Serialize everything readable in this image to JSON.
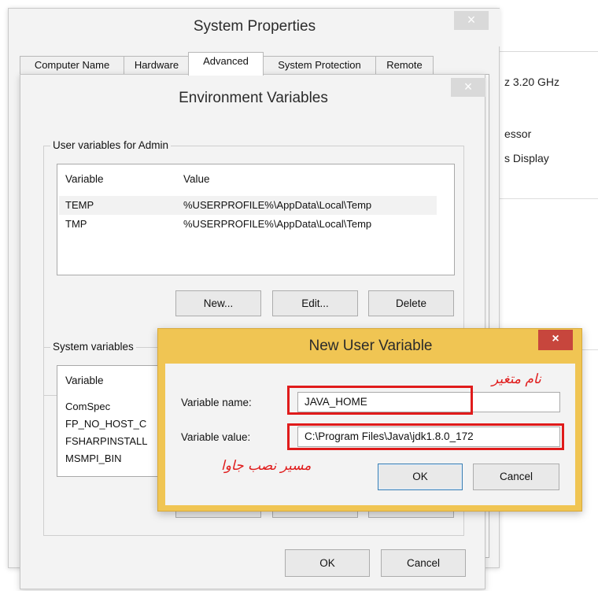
{
  "background_window": {
    "line1": "z  3.20 GHz",
    "line2": "essor",
    "line3": "s Display"
  },
  "system_properties": {
    "title": "System Properties",
    "close_glyph": "×",
    "tabs": [
      "Computer Name",
      "Hardware",
      "Advanced",
      "System Protection",
      "Remote"
    ],
    "active_tab": "Advanced"
  },
  "environment_variables": {
    "title": "Environment Variables",
    "close_glyph": "×",
    "user_group_label": "User variables for Admin",
    "user_columns": [
      "Variable",
      "Value"
    ],
    "user_rows": [
      {
        "variable": "TEMP",
        "value": "%USERPROFILE%\\AppData\\Local\\Temp"
      },
      {
        "variable": "TMP",
        "value": "%USERPROFILE%\\AppData\\Local\\Temp"
      }
    ],
    "user_buttons": {
      "new": "New...",
      "edit": "Edit...",
      "delete": "Delete"
    },
    "system_group_label": "System variables",
    "system_columns": [
      "Variable"
    ],
    "system_rows": [
      "ComSpec",
      "FP_NO_HOST_C",
      "FSHARPINSTALL",
      "MSMPI_BIN"
    ],
    "ok": "OK",
    "cancel": "Cancel"
  },
  "new_user_variable": {
    "title": "New User Variable",
    "close_glyph": "×",
    "name_label": "Variable name:",
    "name_value": "JAVA_HOME",
    "value_label": "Variable value:",
    "value_value": "C:\\Program Files\\Java\\jdk1.8.0_172",
    "ok": "OK",
    "cancel": "Cancel",
    "annotation_name": "نام متغیر",
    "annotation_path": "مسیر نصب جاوا",
    "highlight_color": "#e01b1b"
  }
}
